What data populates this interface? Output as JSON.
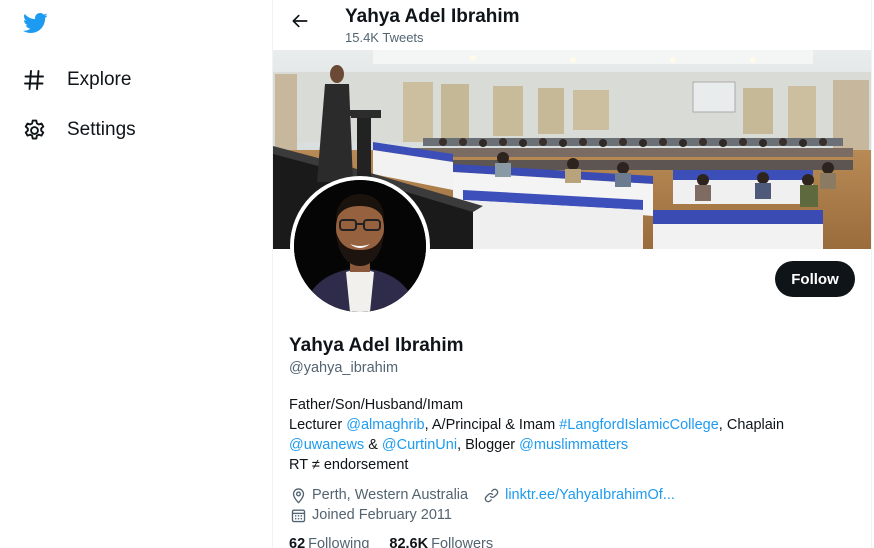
{
  "sidebar": {
    "logo_icon": "twitter-bird-icon",
    "items": [
      {
        "label": "Explore",
        "icon": "hashtag-icon"
      },
      {
        "label": "Settings",
        "icon": "gear-icon"
      }
    ]
  },
  "header": {
    "name": "Yahya Adel Ibrahim",
    "tweet_count": "15.4K Tweets"
  },
  "profile": {
    "name": "Yahya Adel Ibrahim",
    "handle": "@yahya_ibrahim",
    "follow_label": "Follow",
    "bio": {
      "line1": "Father/Son/Husband/Imam",
      "line2_prefix": "Lecturer ",
      "line2_link1": "@almaghrib",
      "line2_mid": ", A/Principal & Imam ",
      "line2_link2": "#LangfordIslamicCollege",
      "line2_suffix": ", Chaplain",
      "line3_link1": "@uwanews",
      "line3_mid1": " & ",
      "line3_link2": "@CurtinUni",
      "line3_mid2": ", Blogger ",
      "line3_link3": "@muslimmatters",
      "line4": "RT ≠ endorsement"
    },
    "location": "Perth, Western Australia",
    "website": "linktr.ee/YahyaIbrahimOf...",
    "joined": "Joined February 2011",
    "following_count": "62",
    "following_label": "Following",
    "followers_count": "82.6K",
    "followers_label": "Followers"
  },
  "colors": {
    "accent": "#1d9bf0",
    "text": "#0f1419",
    "secondary": "#536471",
    "button": "#0f1419"
  }
}
